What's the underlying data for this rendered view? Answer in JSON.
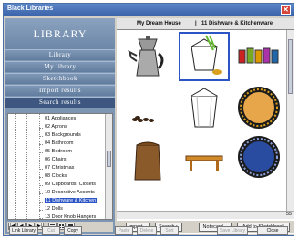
{
  "window": {
    "title": "Black Libraries",
    "close_glyph": "✕"
  },
  "sidebar": {
    "header": "LIBRARY",
    "nav": [
      "Library",
      "My library",
      "Sketchbook",
      "Import results",
      "Search results"
    ],
    "active_index": 4,
    "tree_items": [
      "01 Appliances",
      "02 Aprons",
      "03 Backgrounds",
      "04 Bathroom",
      "05 Bedroom",
      "06 Chairs",
      "07 Christmas",
      "08 Clocks",
      "09 Cupboards, Closets",
      "10 Decorative Accents",
      "11 Dishware & Kitchen",
      "12 Dolls",
      "13 Door Knob Hangers"
    ],
    "pager": [
      "|◀",
      "◀",
      "▶",
      "▶|"
    ],
    "view_icons": [
      "list-view-icon",
      "grid-view-icon",
      "large-view-icon"
    ]
  },
  "breadcrumb": {
    "project": "My Dream House",
    "separator": "|",
    "category": "11 Dishware & Kitchenware"
  },
  "scroll_number": "55",
  "actions": [
    "Import...",
    "Search",
    "Notecard...",
    "Add to Sketchbook"
  ],
  "search_arrow": "▸",
  "bottom_bar": [
    "Link Library",
    "Cut",
    "Copy",
    "Paste",
    "Delete",
    "Sort",
    "Save Library",
    "Close"
  ],
  "bottom_disabled": [
    false,
    true,
    false,
    true,
    true,
    true,
    true,
    false
  ],
  "colors": {
    "accent": "#2b55c4",
    "nav": "#7d96b4",
    "nav_active": "#3d5780",
    "title": "#3a62a8"
  }
}
